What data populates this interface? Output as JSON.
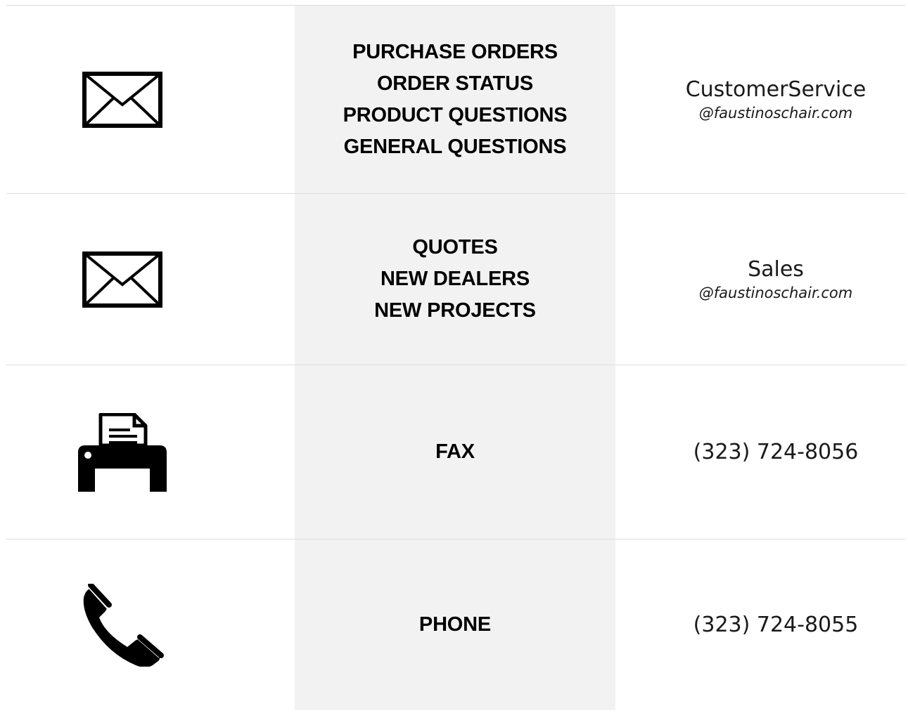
{
  "rows": [
    {
      "icon": "envelope-icon",
      "topics": [
        "PURCHASE ORDERS",
        "ORDER STATUS",
        "PRODUCT QUESTIONS",
        "GENERAL QUESTIONS"
      ],
      "contact": "CustomerService",
      "domain": "@faustinoschair.com"
    },
    {
      "icon": "envelope-icon",
      "topics": [
        "QUOTES",
        "NEW DEALERS",
        "NEW PROJECTS"
      ],
      "contact": "Sales",
      "domain": "@faustinoschair.com"
    },
    {
      "icon": "fax-icon",
      "topics": [
        "FAX"
      ],
      "contact": "(323) 724-8056"
    },
    {
      "icon": "phone-icon",
      "topics": [
        "PHONE"
      ],
      "contact": "(323) 724-8055"
    }
  ],
  "colors": {
    "shaded_column": "#f2f2f2",
    "divider": "#dcdcdc",
    "icon": "#000000"
  }
}
